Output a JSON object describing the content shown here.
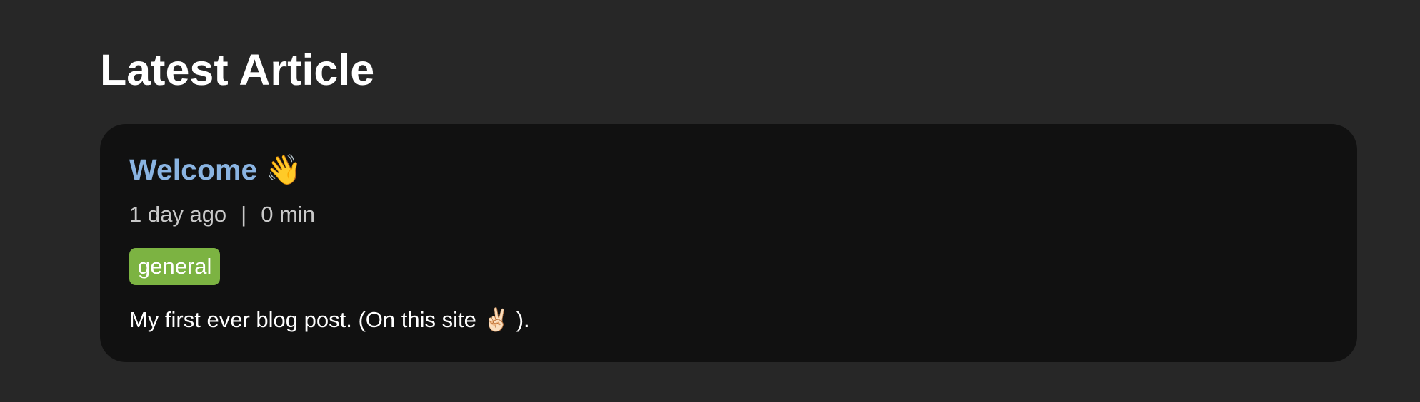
{
  "section": {
    "title": "Latest Article"
  },
  "article": {
    "title": "Welcome",
    "title_emoji": "👋",
    "date": "1 day ago",
    "separator": "|",
    "read_time": "0 min",
    "tags": [
      "general"
    ],
    "summary_before": "My first ever blog post. (On this site",
    "summary_emoji": "✌🏻",
    "summary_after": ")."
  },
  "colors": {
    "page_background": "#272727",
    "card_background": "#111111",
    "title_link": "#8ab4e2",
    "tag_background": "#7cb342",
    "meta_text": "#c9c9c9"
  },
  "icons": {
    "title_emoji": "waving-hand-icon",
    "summary_emoji": "victory-hand-icon"
  }
}
